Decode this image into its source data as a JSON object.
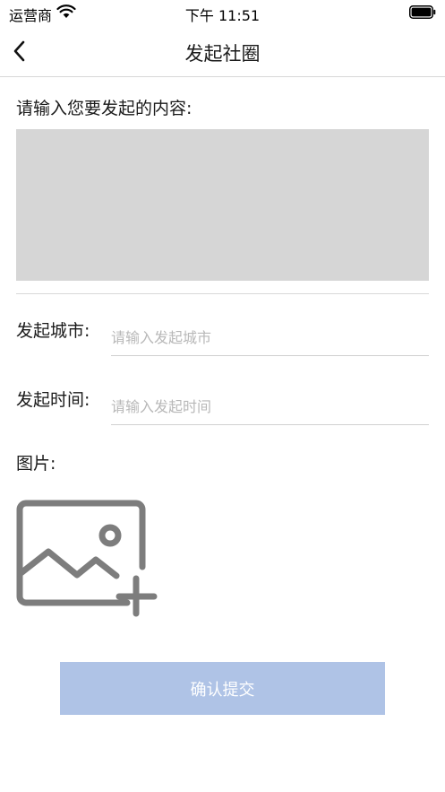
{
  "status_bar": {
    "carrier": "运营商",
    "time": "下午 11:51",
    "icons": [
      "wifi-icon",
      "battery-icon"
    ]
  },
  "nav": {
    "title": "发起社圈",
    "back_icon": "chevron-left-icon"
  },
  "form": {
    "content_label": "请输入您要发起的内容:",
    "content_value": "",
    "city_label": "发起城市:",
    "city_placeholder": "请输入发起城市",
    "city_value": "",
    "time_label": "发起时间:",
    "time_placeholder": "请输入发起时间",
    "time_value": "",
    "image_label": "图片:",
    "add_image_icon": "add-image-icon"
  },
  "submit": {
    "label": "确认提交"
  },
  "colors": {
    "text_area_bg": "#d6d6d6",
    "submit_bg": "#afc3e6",
    "placeholder": "#b8b8b8",
    "icon": "#7d7d7d"
  }
}
